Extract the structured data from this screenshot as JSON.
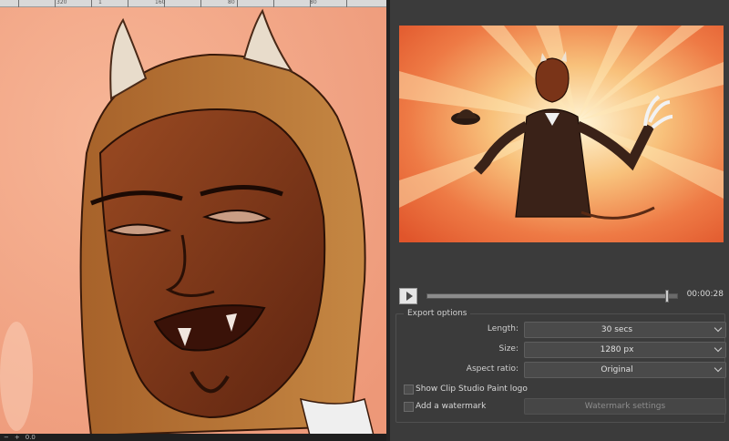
{
  "canvas": {
    "ruler_labels": [
      "320",
      "1",
      "160",
      "80",
      "80"
    ],
    "statusbar": {
      "zoom_out": "−",
      "zoom_in": "+",
      "zoom_value": "0.0"
    }
  },
  "export": {
    "player": {
      "time": "00:00:28",
      "progress": 0.96
    },
    "options_title": "Export options",
    "length": {
      "label": "Length:",
      "value": "30 secs"
    },
    "size": {
      "label": "Size:",
      "value": "1280 px"
    },
    "aspect": {
      "label": "Aspect ratio:",
      "value": "Original"
    },
    "show_logo_label": "Show Clip Studio Paint logo",
    "add_watermark_label": "Add a watermark",
    "watermark_settings_label": "Watermark settings"
  },
  "colors": {
    "canvas_bg": "#f0a585",
    "skin": "#8a3f1d",
    "panel_bg": "#3b3b3b"
  }
}
